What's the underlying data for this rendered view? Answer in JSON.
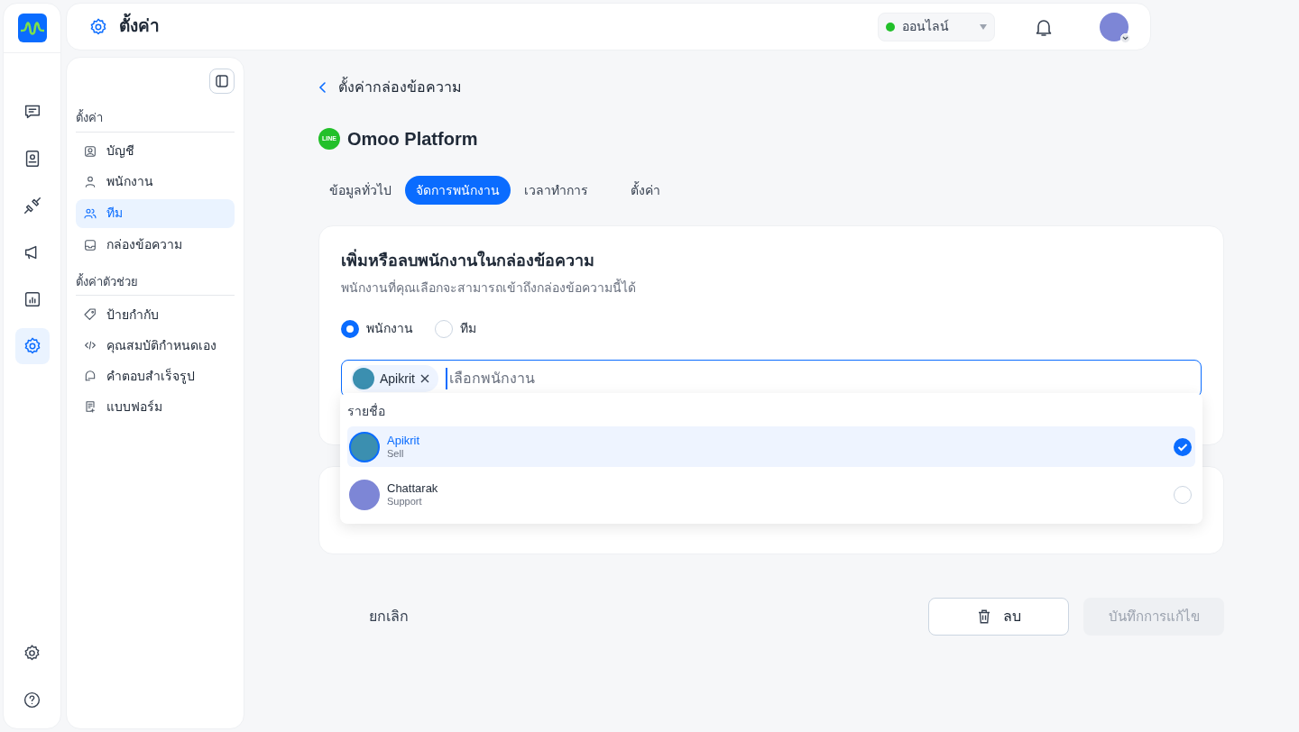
{
  "rail": {
    "items": [
      {
        "kind": "chat",
        "selected": false
      },
      {
        "kind": "contacts",
        "selected": false
      },
      {
        "kind": "plug",
        "selected": false
      },
      {
        "kind": "megaphone",
        "selected": false
      },
      {
        "kind": "chart",
        "selected": false
      },
      {
        "kind": "settings",
        "selected": true
      }
    ],
    "bottom": [
      {
        "kind": "settings"
      },
      {
        "kind": "help"
      }
    ]
  },
  "topbar": {
    "title": "ตั้งค่า",
    "status": {
      "label": "ออนไลน์",
      "color": "#22c02a"
    }
  },
  "sidebar": {
    "sections": [
      {
        "heading": "ตั้งค่า",
        "items": [
          {
            "label": "บัญชี",
            "kind": "account",
            "selected": false
          },
          {
            "label": "พนักงาน",
            "kind": "user",
            "selected": false
          },
          {
            "label": "ทีม",
            "kind": "team",
            "selected": true
          },
          {
            "label": "กล่องข้อความ",
            "kind": "inbox",
            "selected": false
          }
        ]
      },
      {
        "heading": "ตั้งค่าตัวช่วย",
        "items": [
          {
            "label": "ป้ายกำกับ",
            "kind": "tag",
            "selected": false
          },
          {
            "label": "คุณสมบัติกำหนดเอง",
            "kind": "code",
            "selected": false
          },
          {
            "label": "คำตอบสำเร็จรูป",
            "kind": "reply",
            "selected": false
          },
          {
            "label": "แบบฟอร์ม",
            "kind": "form",
            "selected": false
          }
        ]
      }
    ]
  },
  "back_link": "ตั้งค่ากล่องข้อความ",
  "channel": {
    "logo": "LINE",
    "name": "Omoo Platform"
  },
  "tabs": [
    {
      "label": "ข้อมูลทั่วไป",
      "selected": false
    },
    {
      "label": "จัดการพนักงาน",
      "selected": true
    },
    {
      "label": "เวลาทำการ",
      "selected": false
    },
    {
      "label": "ตั้งค่า",
      "selected": false
    }
  ],
  "card": {
    "title": "เพิ่มหรือลบพนักงานในกล่องข้อความ",
    "subtitle": "พนักงานที่คุณเลือกจะสามารถเข้าถึงกล่องข้อความนี้ได้",
    "options": [
      {
        "label": "พนักงาน",
        "selected": true
      },
      {
        "label": "ทีม",
        "selected": false
      }
    ],
    "chips": [
      {
        "label": "Apikrit"
      }
    ],
    "placeholder": "เลือกพนักงาน",
    "dropdown": {
      "heading": "รายชื่อ",
      "items": [
        {
          "name": "Apikrit",
          "role": "Sell",
          "selected": true
        },
        {
          "name": "Chattarak",
          "role": "Support",
          "selected": false
        }
      ]
    }
  },
  "buttons": {
    "cancel": "ยกเลิก",
    "delete": "ลบ",
    "save": {
      "label": "บันทึกการแก้ไข",
      "disabled": true
    }
  }
}
